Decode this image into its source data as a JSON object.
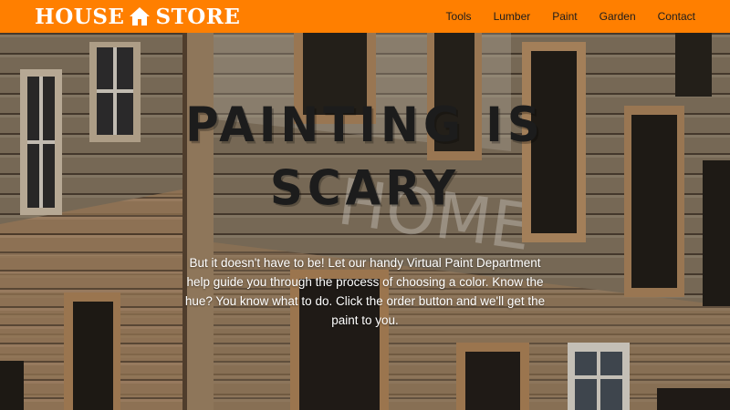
{
  "brand": {
    "left": "HOUSE",
    "right": "STORE",
    "icon": "house-icon"
  },
  "nav": {
    "items": [
      {
        "label": "Tools"
      },
      {
        "label": "Lumber"
      },
      {
        "label": "Paint"
      },
      {
        "label": "Garden"
      },
      {
        "label": "Contact"
      }
    ]
  },
  "hero": {
    "title": "PAINTING IS SCARY",
    "body": "But it doesn't have to be! Let our handy Virtual Paint Department help guide you through the process of choosing a color. Know the hue? You know what to do. Click the order button and we'll get the paint to you.",
    "background_image": "weathered wooden house facade"
  },
  "colors": {
    "header_bg": "#ff7f00",
    "brand_text": "#ffffff",
    "nav_text": "#1d1d1d",
    "title_text": "#1c1c1c",
    "body_text": "#ffffff"
  }
}
